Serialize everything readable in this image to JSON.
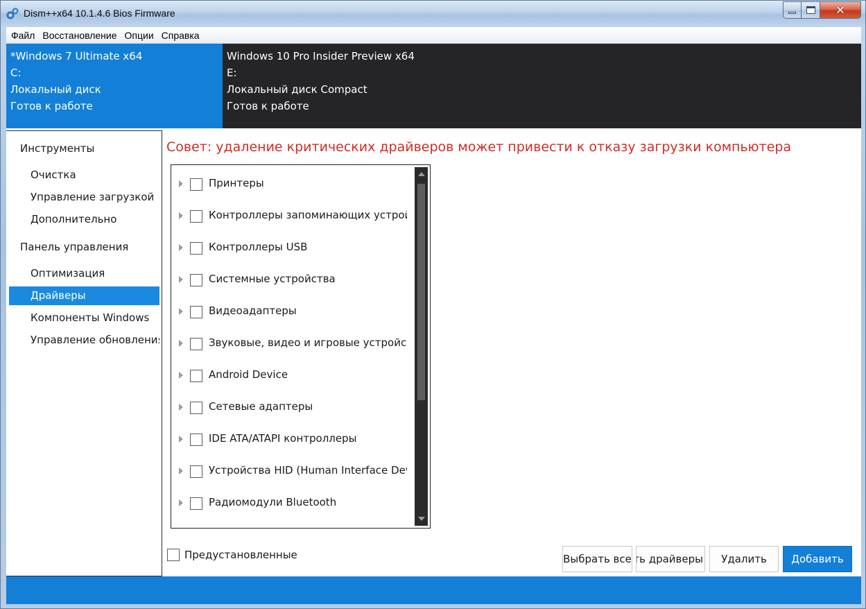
{
  "window": {
    "title": "Dism++x64 10.1.4.6 Bios Firmware",
    "icon": "gear-cluster-icon",
    "controls": {
      "minimize": "minimize-icon",
      "maximize": "maximize-icon",
      "close": "✕"
    }
  },
  "menu": [
    "Файл",
    "Восстановление",
    "Опции",
    "Справка"
  ],
  "sessions": [
    {
      "name": "*Windows 7 Ultimate x64",
      "drive": "C:",
      "disk": "Локальный диск",
      "status": "Готов к работе",
      "active": true
    },
    {
      "name": "Windows 10 Pro Insider Preview x64",
      "drive": "E:",
      "disk": "Локальный диск Compact",
      "status": "Готов к работе",
      "active": false
    }
  ],
  "sidebar": {
    "group1": "Инструменты",
    "group1_items": [
      "Очистка",
      "Управление загрузкой",
      "Дополнительно"
    ],
    "group2": "Панель управления",
    "group2_items": [
      "Оптимизация",
      "Драйверы",
      "Компоненты Windows",
      "Управление обновления"
    ],
    "active_item": "Драйверы"
  },
  "main": {
    "tip": "Совет: удаление критических драйверов может привести к отказу загрузки компьютера",
    "driver_categories": [
      "Принтеры",
      "Контроллеры запоминающих устройств",
      "Контроллеры USB",
      "Системные устройства",
      "Видеоадаптеры",
      "Звуковые, видео и игровые устройства",
      "Android Device",
      "Сетевые адаптеры",
      "IDE ATA/ATAPI контроллеры",
      "Устройства HID (Human Interface Devices)",
      "Радиомодули Bluetooth"
    ],
    "preinstalled_label": "Предустановленные",
    "preinstalled_checked": false
  },
  "buttons": {
    "select_all": "Выбрать все",
    "export": "Экспортировать драйверы",
    "delete": "Удалить",
    "add": "Добавить"
  },
  "colors": {
    "accent": "#137fd7",
    "dark_panel": "#252527",
    "tip": "#d42b23",
    "active_nav": "#1a8ae0"
  }
}
